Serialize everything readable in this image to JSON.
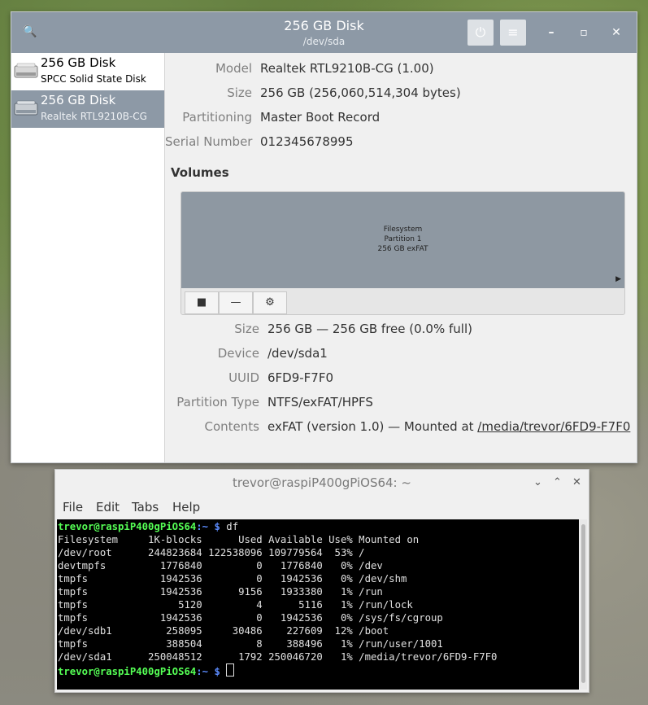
{
  "disks_window": {
    "title": "256 GB Disk",
    "subtitle": "/dev/sda",
    "power_icon": "⏻",
    "menu_icon": "≡",
    "minimize": "–",
    "maximize": "▫",
    "close": "✕",
    "search_icon": "🔍"
  },
  "sidebar": {
    "items": [
      {
        "name": "256 GB Disk",
        "desc": "SPCC Solid State Disk"
      },
      {
        "name": "256 GB Disk",
        "desc": "Realtek RTL9210B-CG"
      }
    ]
  },
  "disk_info": {
    "model_label": "Model",
    "model": "Realtek RTL9210B-CG (1.00)",
    "size_label": "Size",
    "size": "256 GB (256,060,514,304 bytes)",
    "partitioning_label": "Partitioning",
    "partitioning": "Master Boot Record",
    "serial_label": "Serial Number",
    "serial": "012345678995"
  },
  "volumes": {
    "title": "Volumes",
    "partition": {
      "line1": "Filesystem",
      "line2": "Partition 1",
      "line3": "256 GB exFAT"
    },
    "stop_icon": "■",
    "minus_icon": "—",
    "gear_icon": "⚙",
    "size_label": "Size",
    "size": "256 GB — 256 GB free (0.0% full)",
    "device_label": "Device",
    "device": "/dev/sda1",
    "uuid_label": "UUID",
    "uuid": "6FD9-F7F0",
    "ptype_label": "Partition Type",
    "ptype": "NTFS/exFAT/HPFS",
    "contents_label": "Contents",
    "contents": "exFAT (version 1.0) — Mounted at ",
    "mount_link": "/media/trevor/6FD9-F7F0"
  },
  "terminal_window": {
    "title": "trevor@raspiP400gPiOS64: ~",
    "menu": [
      "File",
      "Edit",
      "Tabs",
      "Help"
    ],
    "chev_down": "⌄",
    "chev_up": "⌃",
    "close": "✕",
    "prompt_user": "trevor@raspiP400gPiOS64",
    "prompt_path": ":~ $",
    "command": " df",
    "output": [
      "Filesystem     1K-blocks      Used Available Use% Mounted on",
      "/dev/root      244823684 122538096 109779564  53% /",
      "devtmpfs         1776840         0   1776840   0% /dev",
      "tmpfs            1942536         0   1942536   0% /dev/shm",
      "tmpfs            1942536      9156   1933380   1% /run",
      "tmpfs               5120         4      5116   1% /run/lock",
      "tmpfs            1942536         0   1942536   0% /sys/fs/cgroup",
      "/dev/sdb1         258095     30486    227609  12% /boot",
      "tmpfs             388504         8    388496   1% /run/user/1001",
      "/dev/sda1      250048512      1792 250046720   1% /media/trevor/6FD9-F7F0"
    ]
  }
}
